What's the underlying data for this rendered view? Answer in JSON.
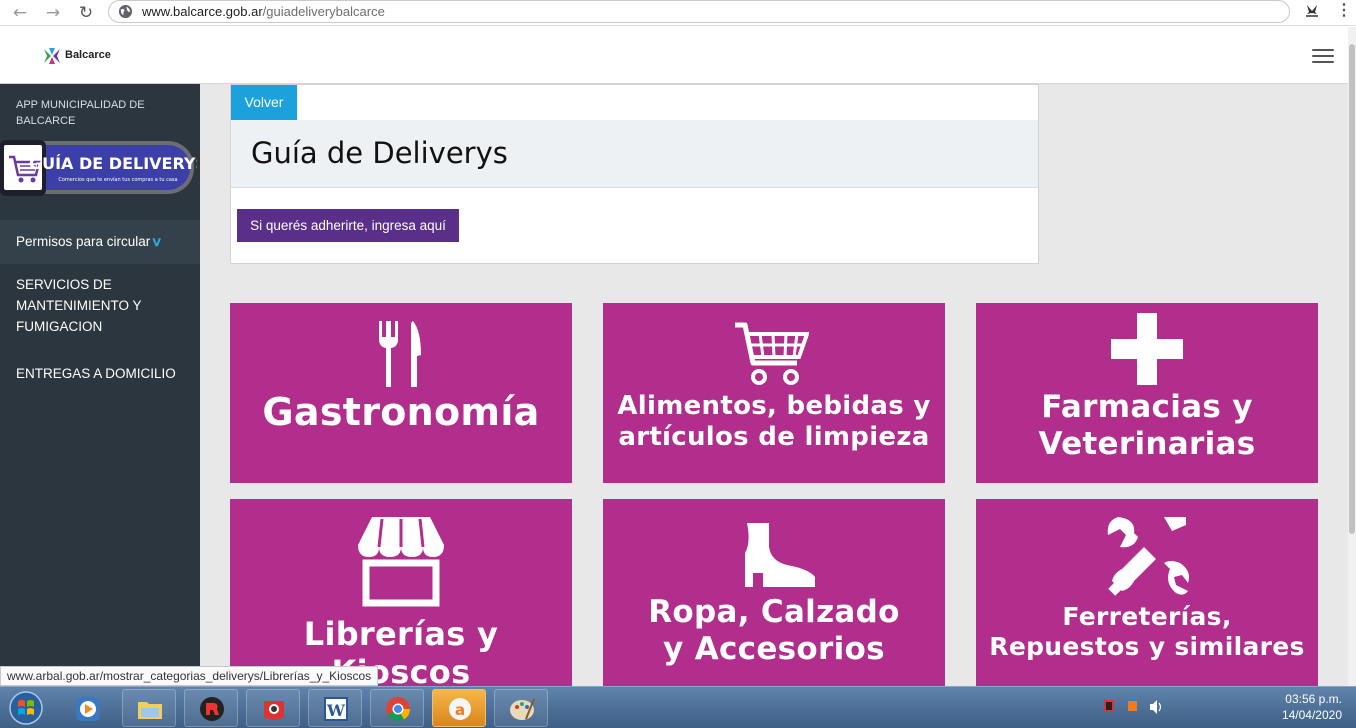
{
  "browser": {
    "url_host": "www.balcarce.gob.ar",
    "url_path": "/guiadeliverybalcarce",
    "back_icon": "arrow-left-icon",
    "forward_icon": "arrow-right-icon",
    "reload_icon": "reload-icon"
  },
  "header": {
    "brand": "Balcarce"
  },
  "sidebar": {
    "app_title": "APP MUNICIPALIDAD DE BALCARCE",
    "banner_title": "GUÍA DE DELIVERYS",
    "banner_subtitle": "Comercios que te envían tus compras a tu casa",
    "items": [
      {
        "label": "Permisos para circular"
      },
      {
        "label": "SERVICIOS DE MANTENIMIENTO Y FUMIGACION"
      },
      {
        "label": "ENTREGAS A DOMICILIO"
      }
    ]
  },
  "card": {
    "back_label": "Volver",
    "title": "Guía de Deliverys",
    "join_label": "Si querés adherirte, ingresa aquí"
  },
  "categories": [
    {
      "line1": "Gastronomía",
      "line2": "",
      "icon": "fork-knife-icon"
    },
    {
      "line1": "Alimentos, bebidas y",
      "line2": "artículos de limpieza",
      "icon": "shopping-cart-icon"
    },
    {
      "line1": "Farmacias y",
      "line2": "Veterinarias",
      "icon": "medical-cross-icon"
    },
    {
      "line1": "Librerías y Kioscos",
      "line2": "",
      "icon": "storefront-icon"
    },
    {
      "line1": "Ropa, Calzado",
      "line2": "y Accesorios",
      "icon": "boot-icon"
    },
    {
      "line1": "Ferreterías,",
      "line2": "Repuestos y similares",
      "icon": "tools-icon"
    }
  ],
  "status_url": "www.arbal.gob.ar/mostrar_categorias_deliverys/Librerías_y_Kioscos",
  "clock": {
    "time": "03:56 p.m.",
    "date": "14/04/2020"
  },
  "colors": {
    "tile": "#b22e8c",
    "sidebar": "#2b363e",
    "accent_blue": "#1da1dc",
    "join_button": "#5a2f8a"
  }
}
